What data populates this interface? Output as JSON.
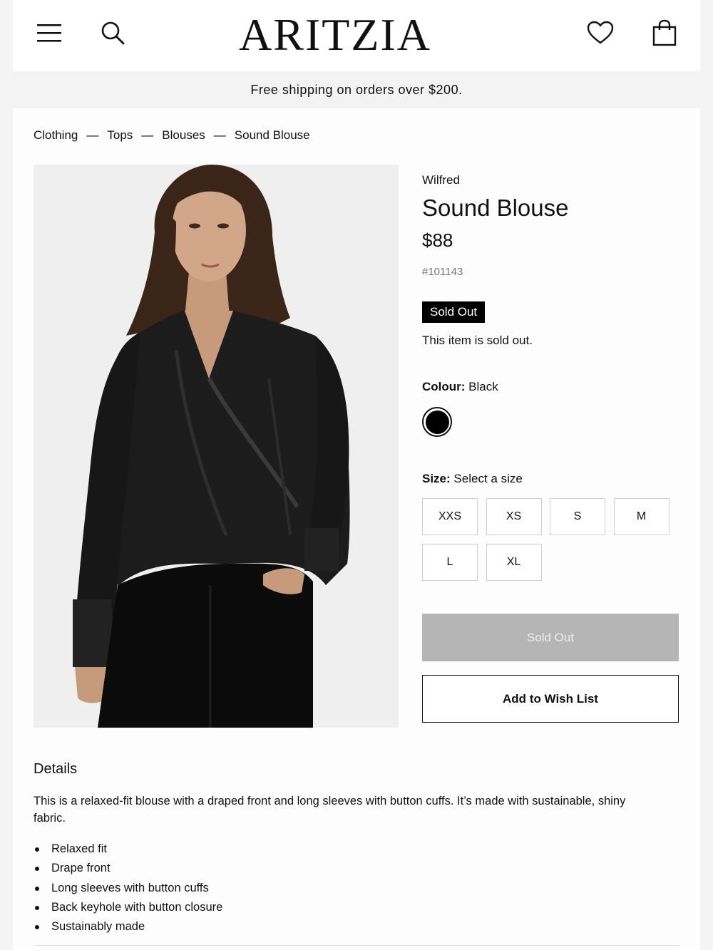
{
  "header": {
    "logo": "ARITZIA",
    "menu_icon": "hamburger-menu-icon",
    "search_icon": "search-icon",
    "wishlist_icon": "heart-icon",
    "bag_icon": "shopping-bag-icon"
  },
  "promo": {
    "text": "Free shipping on orders over $200."
  },
  "breadcrumb": {
    "separator": "—",
    "items": [
      "Clothing",
      "Tops",
      "Blouses",
      "Sound Blouse"
    ]
  },
  "product": {
    "brand": "Wilfred",
    "title": "Sound Blouse",
    "price": "$88",
    "sku": "#101143",
    "badge": "Sold Out",
    "availability_message": "This item is sold out.",
    "colour_label": "Colour:",
    "colour_value": "Black",
    "colour_swatch": "#000000",
    "size_label": "Size:",
    "size_value": "Select a size",
    "sizes": [
      "XXS",
      "XS",
      "S",
      "M",
      "L",
      "XL"
    ],
    "primary_button": "Sold Out",
    "wishlist_button": "Add to Wish List",
    "image_alt": "product-photo-black-satin-blouse"
  },
  "details": {
    "title": "Details",
    "description": "This is a relaxed-fit blouse with a draped front and long sleeves with button cuffs. It’s made with sustainable, shiny fabric.",
    "bullets": [
      "Relaxed fit",
      "Drape front",
      "Long sleeves with button cuffs",
      "Back keyhole with button closure",
      "Sustainably made"
    ]
  },
  "colors": {
    "accent": "#000000",
    "disabled_button": "#b5b5b5",
    "promo_bg": "#f3f3f3"
  }
}
